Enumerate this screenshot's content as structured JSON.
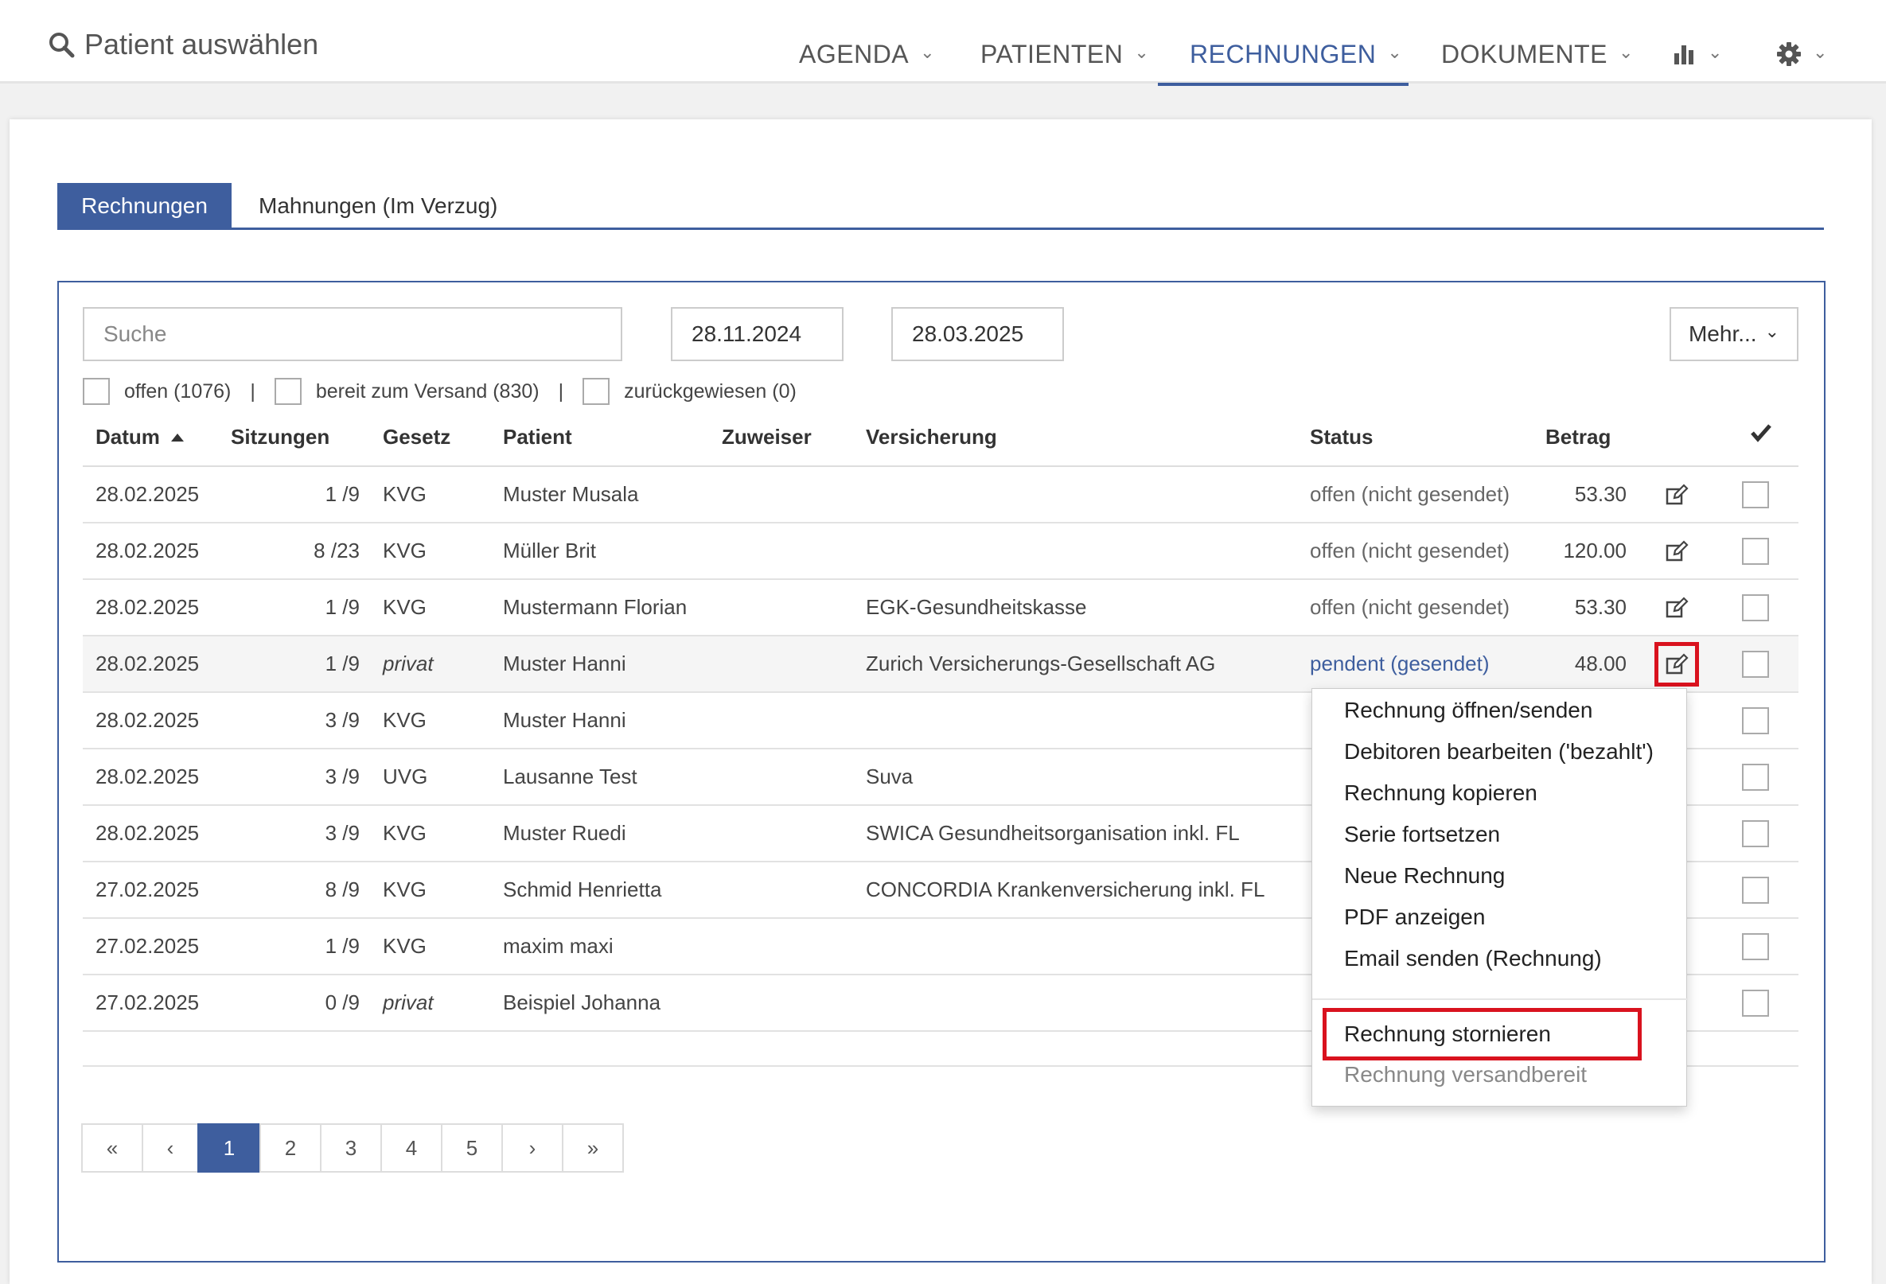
{
  "header": {
    "patient_select": "Patient auswählen",
    "nav": [
      {
        "label": "AGENDA"
      },
      {
        "label": "PATIENTEN"
      },
      {
        "label": "RECHNUNGEN"
      },
      {
        "label": "DOKUMENTE"
      }
    ],
    "active_nav": "RECHNUNGEN",
    "accent_color": "#3e5e9e"
  },
  "tabs": [
    {
      "label": "Rechnungen",
      "active": true
    },
    {
      "label": "Mahnungen (Im Verzug)",
      "active": false
    }
  ],
  "toolbar": {
    "search_placeholder": "Suche",
    "date_from": "28.11.2024",
    "date_to": "28.03.2025",
    "more_label": "Mehr..."
  },
  "filters": [
    {
      "label": "offen (1076)"
    },
    {
      "label": "bereit zum Versand (830)"
    },
    {
      "label": "zurückgewiesen (0)"
    }
  ],
  "filter_separator": "|",
  "table": {
    "columns": [
      "Datum",
      "Sitzungen",
      "Gesetz",
      "Patient",
      "Zuweiser",
      "Versicherung",
      "Status",
      "Betrag"
    ],
    "rows": [
      {
        "datum": "28.02.2025",
        "sitzungen": "1 /9",
        "gesetz": "KVG",
        "patient": "Muster Musala",
        "zuweiser": "",
        "versicherung": "",
        "status": "offen (nicht gesendet)",
        "betrag": "53.30"
      },
      {
        "datum": "28.02.2025",
        "sitzungen": "8 /23",
        "gesetz": "KVG",
        "patient": "Müller Brit",
        "zuweiser": "",
        "versicherung": "",
        "status": "offen (nicht gesendet)",
        "betrag": "120.00"
      },
      {
        "datum": "28.02.2025",
        "sitzungen": "1 /9",
        "gesetz": "KVG",
        "patient": "Mustermann Florian",
        "zuweiser": "",
        "versicherung": "EGK-Gesundheitskasse",
        "status": "offen (nicht gesendet)",
        "betrag": "53.30"
      },
      {
        "datum": "28.02.2025",
        "sitzungen": "1 /9",
        "gesetz": "privat",
        "patient": "Muster Hanni",
        "zuweiser": "",
        "versicherung": "Zurich Versicherungs-Gesellschaft AG",
        "status": "pendent (gesendet)",
        "betrag": "48.00"
      },
      {
        "datum": "28.02.2025",
        "sitzungen": "3 /9",
        "gesetz": "KVG",
        "patient": "Muster Hanni",
        "zuweiser": "",
        "versicherung": "",
        "status": "",
        "betrag": ""
      },
      {
        "datum": "28.02.2025",
        "sitzungen": "3 /9",
        "gesetz": "UVG",
        "patient": "Lausanne Test",
        "zuweiser": "",
        "versicherung": "Suva",
        "status": "",
        "betrag": ""
      },
      {
        "datum": "28.02.2025",
        "sitzungen": "3 /9",
        "gesetz": "KVG",
        "patient": "Muster Ruedi",
        "zuweiser": "",
        "versicherung": "SWICA Gesundheitsorganisation inkl. FL",
        "status": "",
        "betrag": ""
      },
      {
        "datum": "27.02.2025",
        "sitzungen": "8 /9",
        "gesetz": "KVG",
        "patient": "Schmid Henrietta",
        "zuweiser": "",
        "versicherung": "CONCORDIA Krankenversicherung inkl. FL",
        "status": "",
        "betrag": ""
      },
      {
        "datum": "27.02.2025",
        "sitzungen": "1 /9",
        "gesetz": "KVG",
        "patient": "maxim maxi",
        "zuweiser": "",
        "versicherung": "",
        "status": "",
        "betrag": ""
      },
      {
        "datum": "27.02.2025",
        "sitzungen": "0 /9",
        "gesetz": "privat",
        "patient": "Beispiel Johanna",
        "zuweiser": "",
        "versicherung": "",
        "status": "",
        "betrag": ""
      }
    ]
  },
  "pagination": [
    "«",
    "‹",
    "1",
    "2",
    "3",
    "4",
    "5",
    "›",
    "»"
  ],
  "current_page": "1",
  "context_menu": {
    "items": [
      "Rechnung öffnen/senden",
      "Debitoren bearbeiten ('bezahlt')",
      "Rechnung kopieren",
      "Serie fortsetzen",
      "Neue Rechnung",
      "PDF anzeigen",
      "Email senden (Rechnung)"
    ],
    "items_after_divider": [
      "Rechnung stornieren",
      "Rechnung versandbereit"
    ],
    "highlight_color": "#d9121e"
  }
}
